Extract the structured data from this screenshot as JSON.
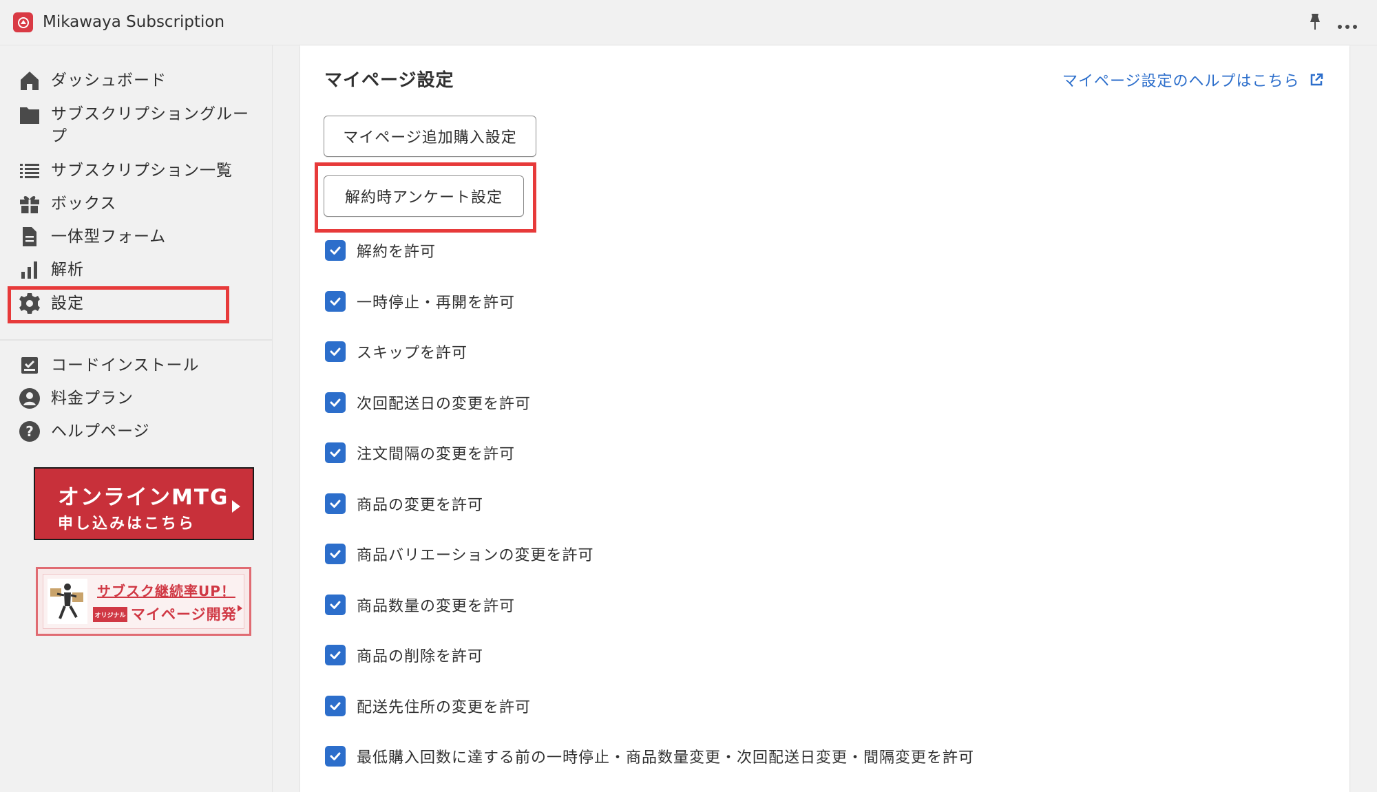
{
  "app": {
    "title": "Mikawaya Subscription",
    "logo_icon": "app-logo-icon"
  },
  "topbar": {
    "pin_icon": "pin-icon",
    "more_icon": "more-icon"
  },
  "sidebar": {
    "items": [
      {
        "label": "ダッシュボード",
        "icon": "home-icon"
      },
      {
        "label": "サブスクリプショングループ",
        "icon": "folder-icon"
      },
      {
        "label": "サブスクリプション一覧",
        "icon": "list-icon"
      },
      {
        "label": "ボックス",
        "icon": "gift-icon"
      },
      {
        "label": "一体型フォーム",
        "icon": "document-icon"
      },
      {
        "label": "解析",
        "icon": "bar-chart-icon"
      },
      {
        "label": "設定",
        "icon": "gear-icon"
      }
    ],
    "secondary_items": [
      {
        "label": "コードインストール",
        "icon": "inbox-check-icon"
      },
      {
        "label": "料金プラン",
        "icon": "user-circle-icon"
      },
      {
        "label": "ヘルプページ",
        "icon": "question-circle-icon"
      }
    ],
    "banner_mtg": {
      "line1": "オンラインMTG",
      "line2": "申し込みはこちら",
      "color": "#c8303a"
    },
    "banner_mypage": {
      "line1": "サブスク継続率UP！",
      "tag": "オリジナル",
      "line2": "マイページ開発",
      "color": "#d03844"
    }
  },
  "main": {
    "title": "マイページ設定",
    "help_link": "マイページ設定のヘルプはこちら",
    "buttons": [
      {
        "label": "マイページ追加購入設定"
      },
      {
        "label": "解約時アンケート設定"
      }
    ],
    "checkboxes": [
      {
        "label": "解約を許可",
        "checked": true
      },
      {
        "label": "一時停止・再開を許可",
        "checked": true
      },
      {
        "label": "スキップを許可",
        "checked": true
      },
      {
        "label": "次回配送日の変更を許可",
        "checked": true
      },
      {
        "label": "注文間隔の変更を許可",
        "checked": true
      },
      {
        "label": "商品の変更を許可",
        "checked": true
      },
      {
        "label": "商品バリエーションの変更を許可",
        "checked": true
      },
      {
        "label": "商品数量の変更を許可",
        "checked": true
      },
      {
        "label": "商品の削除を許可",
        "checked": true
      },
      {
        "label": "配送先住所の変更を許可",
        "checked": true
      },
      {
        "label": "最低購入回数に達する前の一時停止・商品数量変更・次回配送日変更・間隔変更を許可",
        "checked": true
      }
    ]
  },
  "colors": {
    "accent": "#2c6ecb",
    "highlight": "#e73a3a",
    "background": "#f1f1f1",
    "card": "#ffffff"
  }
}
